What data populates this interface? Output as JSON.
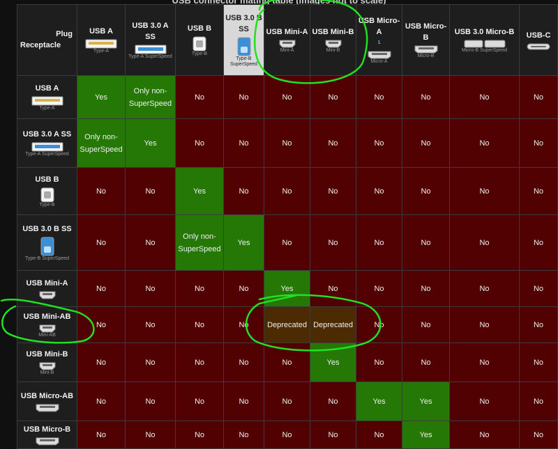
{
  "caption": "USB connector mating table (images not to scale)",
  "corner": {
    "plug": "Plug",
    "receptacle": "Receptacle"
  },
  "columns": [
    {
      "key": "usb-a",
      "name": "USB A",
      "cap": "Type-A"
    },
    {
      "key": "usb-3-a-ss",
      "name": "USB 3.0 A SS",
      "cap": "Type-A SuperSpeed"
    },
    {
      "key": "usb-b",
      "name": "USB B",
      "cap": "Type-B"
    },
    {
      "key": "usb-3-b-ss",
      "name": "USB 3.0 B SS",
      "cap": "Type-B SuperSpeed",
      "highlight": true
    },
    {
      "key": "usb-mini-a",
      "name": "USB Mini-A",
      "cap": "Mini-A"
    },
    {
      "key": "usb-mini-b",
      "name": "USB Mini-B",
      "cap": "Mini-B"
    },
    {
      "key": "usb-micro-a",
      "name": "USB Micro-A",
      "cap": "Micro-A",
      "footnote": "1"
    },
    {
      "key": "usb-micro-b",
      "name": "USB Micro-B",
      "cap": "Micro-B"
    },
    {
      "key": "usb-3-micro-b",
      "name": "USB 3.0 Micro-B",
      "cap": "Micro-B SuperSpeed"
    },
    {
      "key": "usb-c",
      "name": "USB-C",
      "cap": ""
    }
  ],
  "rows": [
    {
      "key": "usb-a",
      "name": "USB A",
      "cap": "Type-A",
      "cells": [
        "Yes",
        "Only non-SuperSpeed",
        "No",
        "No",
        "No",
        "No",
        "No",
        "No",
        "No",
        "No"
      ]
    },
    {
      "key": "usb-3-a-ss",
      "name": "USB 3.0 A SS",
      "cap": "Type-A SuperSpeed",
      "cells": [
        "Only non-SuperSpeed",
        "Yes",
        "No",
        "No",
        "No",
        "No",
        "No",
        "No",
        "No",
        "No"
      ]
    },
    {
      "key": "usb-b",
      "name": "USB B",
      "cap": "Type-B",
      "cells": [
        "No",
        "No",
        "Yes",
        "No",
        "No",
        "No",
        "No",
        "No",
        "No",
        "No"
      ]
    },
    {
      "key": "usb-3-b-ss",
      "name": "USB 3.0 B SS",
      "cap": "Type-B SuperSpeed",
      "cells": [
        "No",
        "No",
        "Only non-SuperSpeed",
        "Yes",
        "No",
        "No",
        "No",
        "No",
        "No",
        "No"
      ]
    },
    {
      "key": "usb-mini-a",
      "name": "USB Mini-A",
      "cap": "",
      "cells": [
        "No",
        "No",
        "No",
        "No",
        "Yes",
        "No",
        "No",
        "No",
        "No",
        "No"
      ]
    },
    {
      "key": "usb-mini-ab",
      "name": "USB Mini-AB",
      "cap": "Mini-AB",
      "cells": [
        "No",
        "No",
        "No",
        "No",
        "Deprecated",
        "Deprecated",
        "No",
        "No",
        "No",
        "No"
      ]
    },
    {
      "key": "usb-mini-b",
      "name": "USB Mini-B",
      "cap": "Mini-B",
      "cells": [
        "No",
        "No",
        "No",
        "No",
        "No",
        "Yes",
        "No",
        "No",
        "No",
        "No"
      ]
    },
    {
      "key": "usb-micro-ab",
      "name": "USB Micro-AB",
      "cap": "",
      "cells": [
        "No",
        "No",
        "No",
        "No",
        "No",
        "No",
        "Yes",
        "Yes",
        "No",
        "No"
      ]
    },
    {
      "key": "usb-micro-b",
      "name": "USB Micro-B",
      "cap": "",
      "cells": [
        "No",
        "No",
        "No",
        "No",
        "No",
        "No",
        "No",
        "Yes",
        "No",
        "No"
      ]
    }
  ],
  "status_colors": {
    "Yes": "#257805",
    "Only non-SuperSpeed": "#257805",
    "No": "#510101",
    "Deprecated": "#4c2a02"
  },
  "annotation_color": "#22e022"
}
